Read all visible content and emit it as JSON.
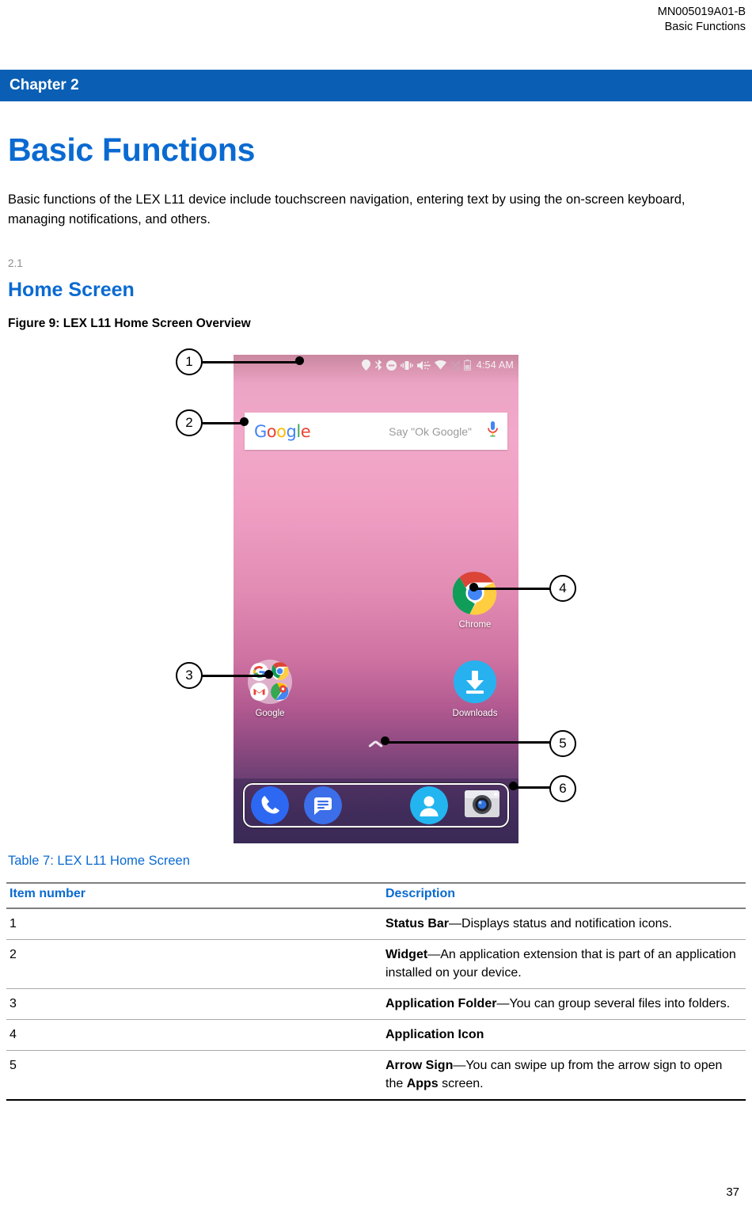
{
  "header": {
    "doc_id": "MN005019A01-B",
    "doc_section": "Basic Functions"
  },
  "chapter": {
    "label": "Chapter 2"
  },
  "title": "Basic Functions",
  "intro": "Basic functions of the LEX L11 device include touchscreen navigation, entering text by using the on-screen keyboard, managing notifications, and others.",
  "section": {
    "number": "2.1",
    "title": "Home Screen"
  },
  "figure": {
    "caption": "Figure 9: LEX L11 Home Screen Overview",
    "callouts": [
      "1",
      "2",
      "3",
      "4",
      "5",
      "6"
    ],
    "phone": {
      "statusbar": {
        "time": "4:54 AM",
        "icons": [
          "location-icon",
          "bluetooth-icon",
          "do-not-disturb-icon",
          "vibrate-icon",
          "volume-icon",
          "wifi-icon",
          "signal-off-icon",
          "battery-icon"
        ]
      },
      "widget": {
        "logo": "Google",
        "hint": "Say \"Ok Google\"",
        "mic_icon": "microphone-icon"
      },
      "apps": [
        {
          "name": "Chrome",
          "icon": "chrome-icon"
        },
        {
          "name": "Downloads",
          "icon": "downloads-icon"
        },
        {
          "name": "Google",
          "icon": "google-folder-icon"
        }
      ],
      "folder_contents": [
        "google-icon",
        "chrome-icon",
        "gmail-icon",
        "maps-icon"
      ],
      "arrow_sign": "chevron-up-icon",
      "dock": [
        {
          "name": "phone-app",
          "icon": "phone-icon"
        },
        {
          "name": "messages-app",
          "icon": "messages-icon"
        },
        {
          "name": "contacts-app",
          "icon": "contacts-icon"
        },
        {
          "name": "camera-app",
          "icon": "camera-icon"
        }
      ]
    }
  },
  "table": {
    "caption": "Table 7: LEX L11 Home Screen",
    "columns": [
      "Item number",
      "Description"
    ],
    "rows": [
      {
        "num": "1",
        "term": "Status Bar",
        "desc": "—Displays status and notification icons."
      },
      {
        "num": "2",
        "term": "Widget",
        "desc": "—An application extension that is part of an application installed on your device."
      },
      {
        "num": "3",
        "term": "Application Folder",
        "desc": "—You can group several files into folders."
      },
      {
        "num": "4",
        "term": "Application Icon",
        "desc": ""
      },
      {
        "num": "5",
        "term": "Arrow Sign",
        "desc": "—You can swipe up from the arrow sign to open the ",
        "desc_bold": "Apps",
        "desc_tail": " screen."
      }
    ]
  },
  "page_number": "37",
  "colors": {
    "accent_blue": "#0a6ad1",
    "banner_blue": "#0a5fb4",
    "rule_gray": "#7f7f7f",
    "section_num_gray": "#8c8c8c"
  }
}
